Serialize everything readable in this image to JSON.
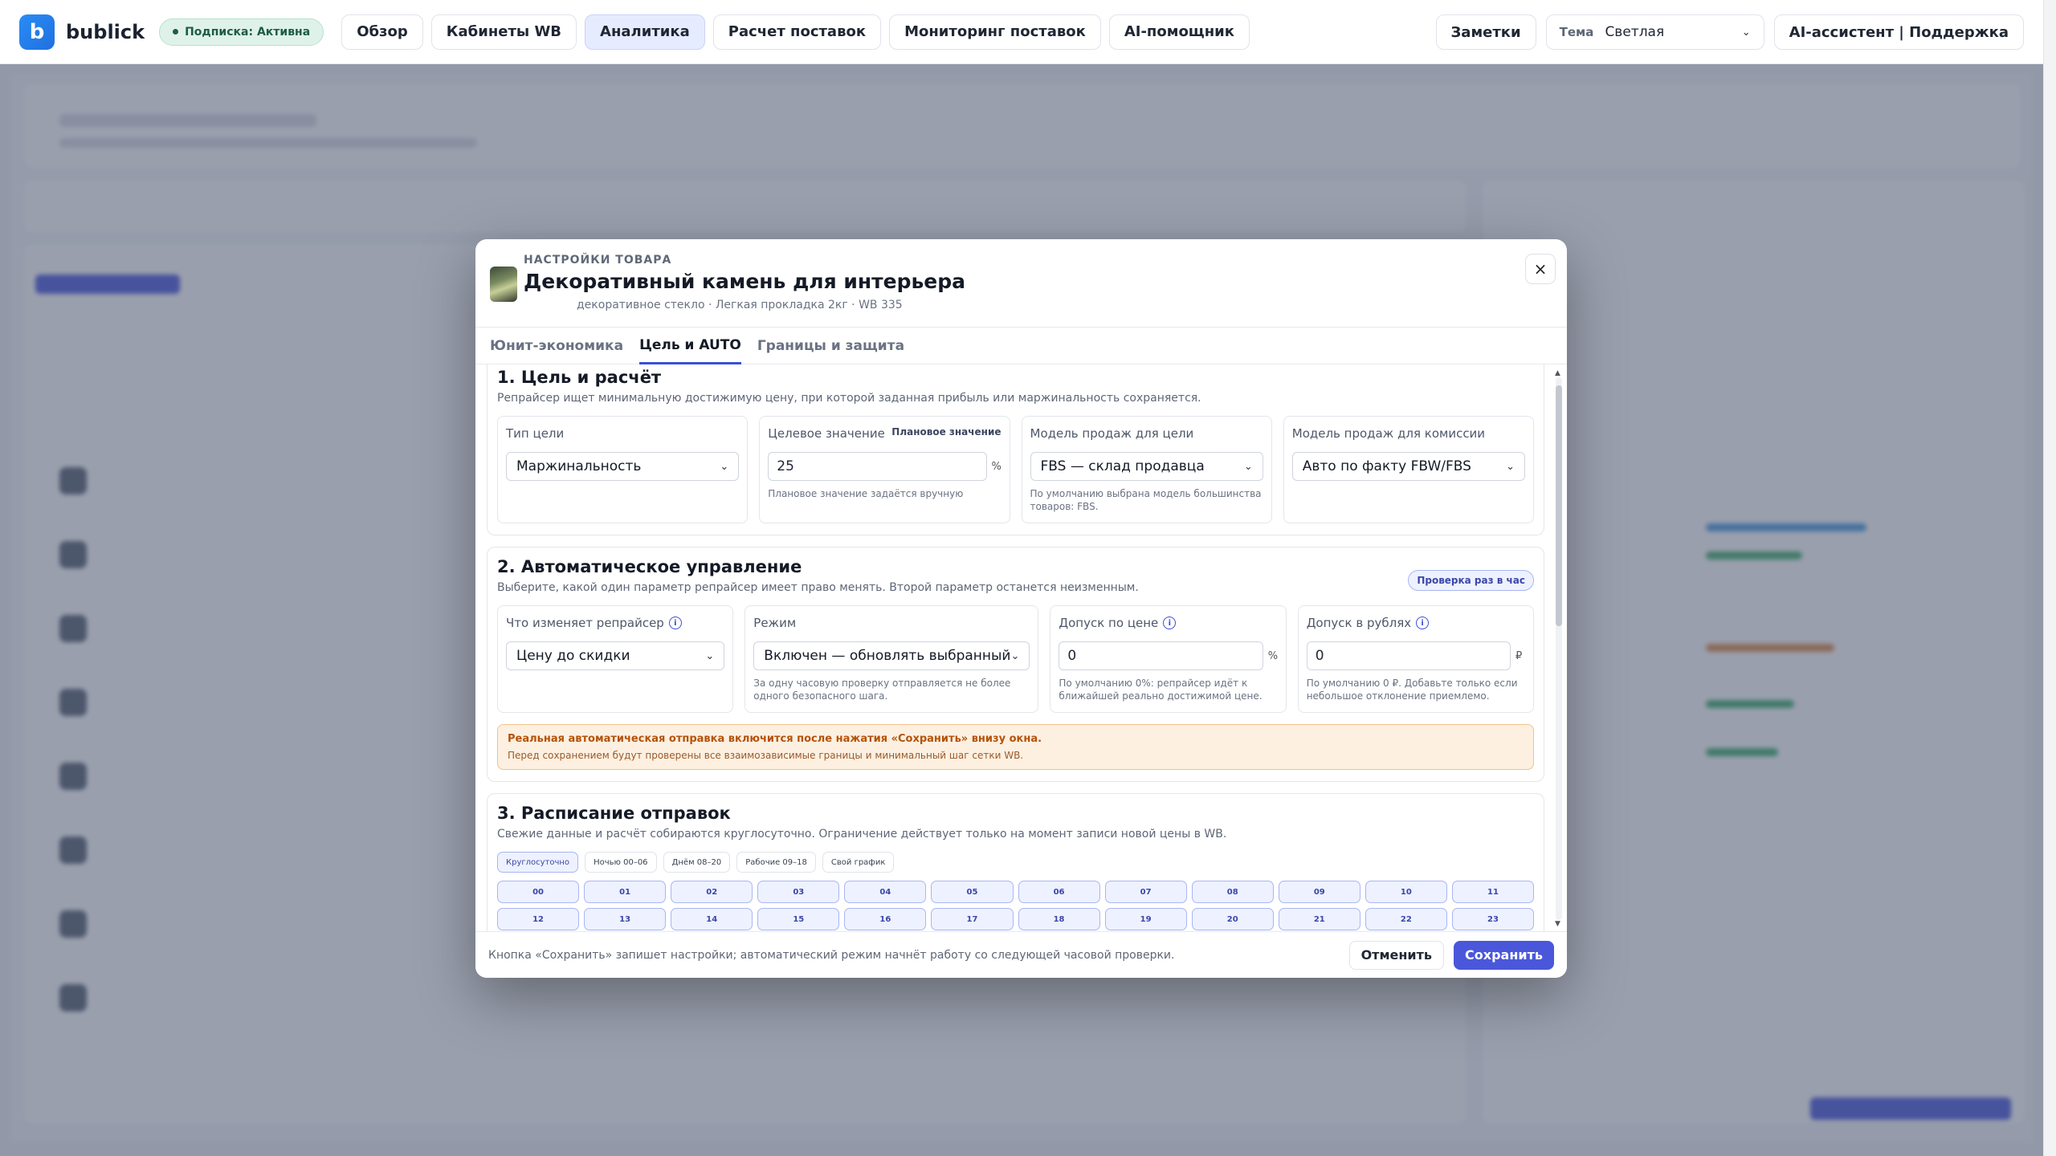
{
  "topbar": {
    "logo_letter": "b",
    "brand": "bublick",
    "subscription": "Подписка: Активна",
    "nav": [
      {
        "label": "Обзор",
        "active": false
      },
      {
        "label": "Кабинеты WB",
        "active": false
      },
      {
        "label": "Аналитика",
        "active": true
      },
      {
        "label": "Расчет поставок",
        "active": false
      },
      {
        "label": "Мониторинг поставок",
        "active": false
      },
      {
        "label": "AI-помощник",
        "active": false
      }
    ],
    "notes_label": "Заметки",
    "theme_label": "Тема",
    "theme_value": "Светлая",
    "assistant_label": "AI-ассистент | Поддержка"
  },
  "modal": {
    "eyebrow": "НАСТРОЙКИ ТОВАРА",
    "title": "Декоративный камень для интерьера",
    "subtitle": "декоративное стекло · Легкая прокладка 2кг · WB 335",
    "close": "×",
    "tabs": [
      {
        "label": "Юнит-экономика",
        "active": false
      },
      {
        "label": "Цель и AUTO",
        "active": true
      },
      {
        "label": "Границы и защита",
        "active": false
      }
    ],
    "section1": {
      "title": "1. Цель и расчёт",
      "desc": "Репрайсер ищет минимальную достижимую цену, при которой заданная прибыль или маржинальность сохраняется.",
      "goal_type": {
        "label": "Тип цели",
        "value": "Маржинальность"
      },
      "target": {
        "label": "Целевое значение",
        "tag": "Плановое значение",
        "value": "25",
        "unit": "%",
        "hint": "Плановое значение задаётся вручную"
      },
      "sales_model": {
        "label": "Модель продаж для цели",
        "value": "FBS — склад продавца",
        "hint": "По умолчанию выбрана модель большинства товаров: FBS."
      },
      "commission_model": {
        "label": "Модель продаж для комиссии",
        "value": "Авто по факту FBW/FBS"
      }
    },
    "section2": {
      "title": "2. Автоматическое управление",
      "desc": "Выберите, какой один параметр репрайсер имеет право менять. Второй параметр останется неизменным.",
      "badge": "Проверка раз в час",
      "param": {
        "label": "Что изменяет репрайсер",
        "value": "Цену до скидки"
      },
      "mode": {
        "label": "Режим",
        "value": "Включен — обновлять выбранный",
        "hint": "За одну часовую проверку отправляется не более одного безопасного шага."
      },
      "price_tol": {
        "label": "Допуск по цене",
        "value": "0",
        "unit": "%",
        "hint": "По умолчанию 0%: репрайсер идёт к ближайшей реально достижимой цене."
      },
      "rub_tol": {
        "label": "Допуск в рублях",
        "value": "0",
        "unit": "₽",
        "hint": "По умолчанию 0 ₽. Добавьте только если небольшое отклонение приемлемо."
      },
      "alert_title": "Реальная автоматическая отправка включится после нажатия «Сохранить» внизу окна.",
      "alert_text": "Перед сохранением будут проверены все взаимозависимые границы и минимальный шаг сетки WB."
    },
    "section3": {
      "title": "3. Расписание отправок",
      "desc": "Свежие данные и расчёт собираются круглосуточно. Ограничение действует только на момент записи новой цены в WB.",
      "presets": [
        {
          "label": "Круглосуточно",
          "active": true
        },
        {
          "label": "Ночью 00–06",
          "active": false
        },
        {
          "label": "Днём 08–20",
          "active": false
        },
        {
          "label": "Рабочие 09–18",
          "active": false
        },
        {
          "label": "Свой график",
          "active": false
        }
      ],
      "hours": [
        "00",
        "01",
        "02",
        "03",
        "04",
        "05",
        "06",
        "07",
        "08",
        "09",
        "10",
        "11",
        "12",
        "13",
        "14",
        "15",
        "16",
        "17",
        "18",
        "19",
        "20",
        "21",
        "22",
        "23"
      ]
    },
    "footer": {
      "note": "Кнопка «Сохранить» запишет настройки; автоматический режим начнёт работу со следующей часовой проверки.",
      "cancel": "Отменить",
      "save": "Сохранить"
    }
  }
}
